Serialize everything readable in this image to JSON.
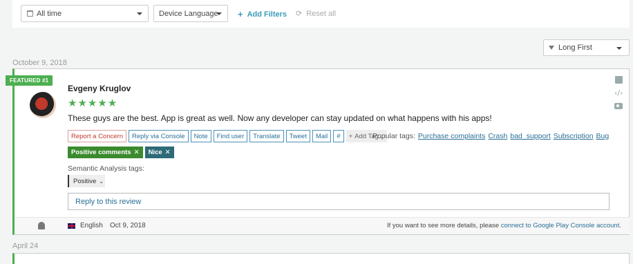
{
  "filters": {
    "time_range": "All time",
    "device_language": "Device Language",
    "add_filters": "Add Filters",
    "reset_all": "Reset all"
  },
  "sort": {
    "selected": "Long First"
  },
  "groups": [
    {
      "date": "October 9, 2018"
    },
    {
      "date": "April 24"
    }
  ],
  "review": {
    "featured": "FEATURED #1",
    "author": "Evgeny Kruglov",
    "rating": 5,
    "stars": "★★★★★",
    "text": "These guys are the best. App is great as well. Now any developer can stay updated on what happens with his apps!",
    "actions": [
      "Report a Concern",
      "Reply via Console",
      "Note",
      "Find user",
      "Translate",
      "Tweet",
      "Mail",
      "#",
      "Add Tag..."
    ],
    "popular_label": "Popular tags:",
    "popular_tags": [
      "Purchase complaints",
      "Crash",
      "bad_support",
      "Subscription",
      "Bug"
    ],
    "applied_tags": [
      "Positive comments",
      "Nice"
    ],
    "semantic_label": "Semantic Analysis tags:",
    "semantic_value": "Positive",
    "reply_placeholder": "Reply to this review",
    "language": "English",
    "date": "Oct 9, 2018",
    "note_prefix": "If you want to see more details, please ",
    "note_link": "connect to Google Play Console account",
    "note_suffix": "."
  },
  "colors": {
    "accent": "#4caf50",
    "link": "#2a6f97",
    "tag_green": "#3b8b2e",
    "tag_teal": "#2e6a78"
  }
}
